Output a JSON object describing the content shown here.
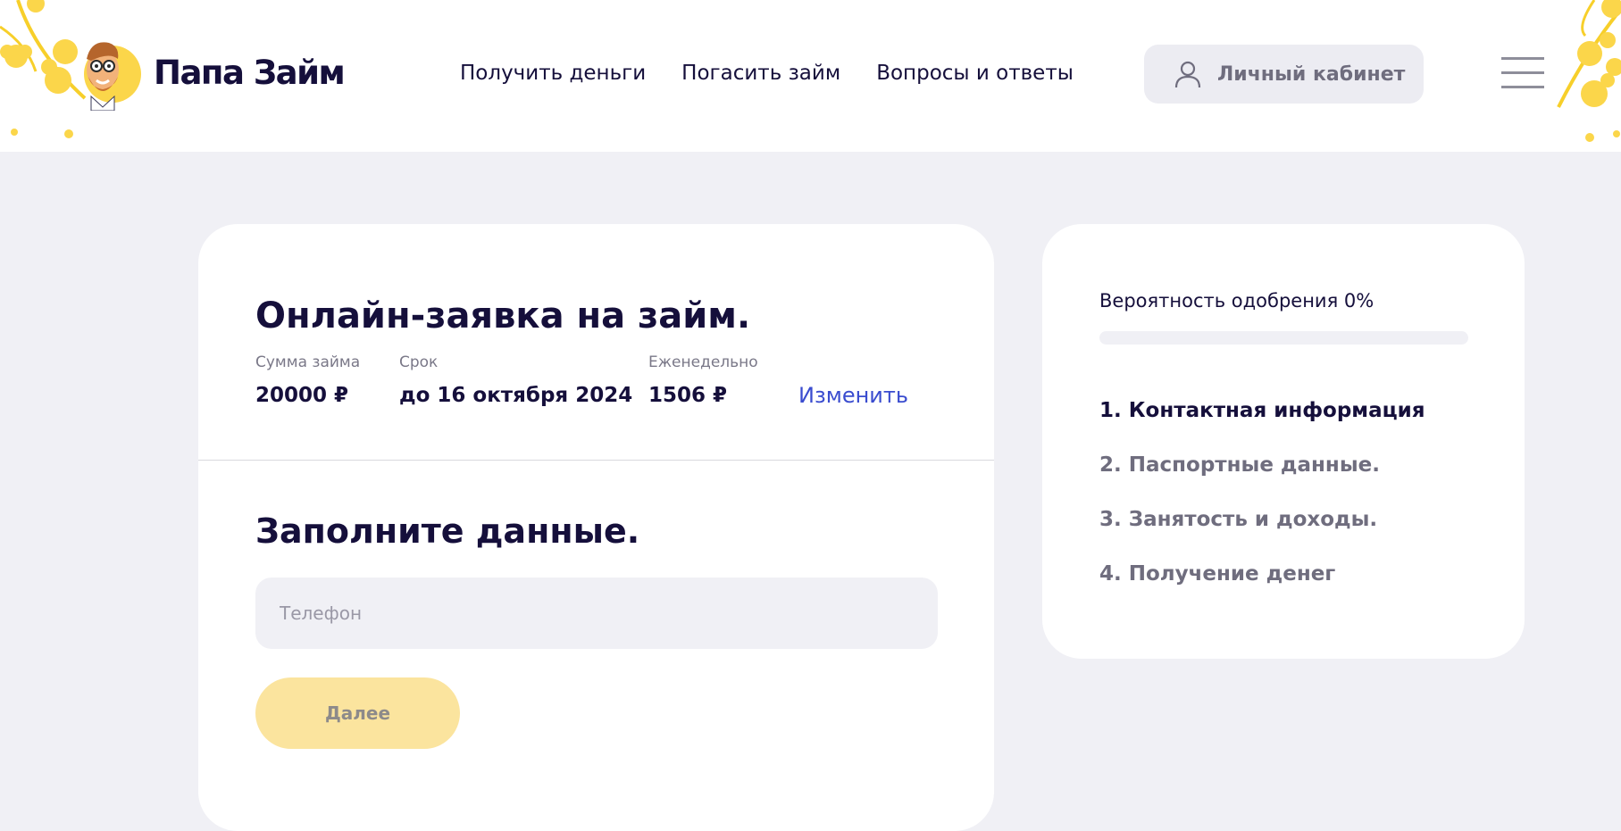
{
  "header": {
    "logo_text": "Папа Займ",
    "nav": [
      {
        "label": "Получить деньги"
      },
      {
        "label": "Погасить займ"
      },
      {
        "label": "Вопросы и ответы"
      }
    ],
    "cabinet_label": "Личный кабинет"
  },
  "application": {
    "title": "Онлайн-заявка на займ.",
    "loan": {
      "amount_label": "Сумма займа",
      "amount_value": "20000 ₽",
      "term_label": "Срок",
      "term_value": "до 16 октября 2024",
      "weekly_label": "Еженедельно",
      "weekly_value": "1506 ₽",
      "change_link": "Изменить"
    },
    "form_title": "Заполните данные.",
    "phone_placeholder": "Телефон",
    "next_button": "Далее"
  },
  "sidebar": {
    "probability_label": "Вероятность одобрения 0%",
    "probability_value": 0,
    "steps": [
      {
        "label": "1. Контактная информация",
        "active": true
      },
      {
        "label": "2. Паспортные данные.",
        "active": false
      },
      {
        "label": "3. Занятость и доходы.",
        "active": false
      },
      {
        "label": "4. Получение денег",
        "active": false
      }
    ]
  },
  "colors": {
    "accent_yellow": "#fbd64a",
    "button_disabled": "#fbe49e",
    "link_blue": "#3a4ccf",
    "text_dark": "#150f3b",
    "page_bg": "#f0f0f5"
  },
  "icons": [
    "logo-avatar-icon",
    "user-icon",
    "menu-icon",
    "flower-decoration-icon"
  ]
}
